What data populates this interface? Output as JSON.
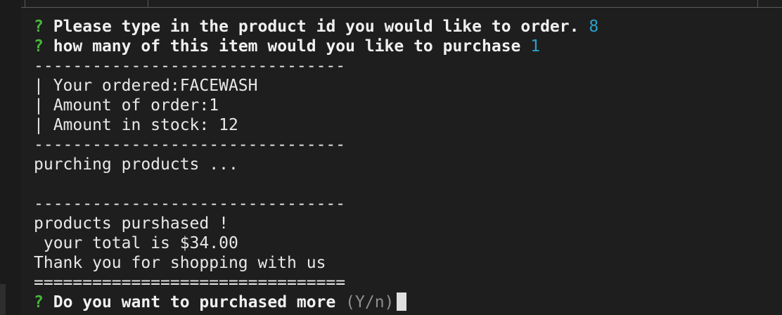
{
  "terminal": {
    "q1": {
      "mark": "?",
      "prompt": "Please type in the product id you would like to order.",
      "answer": "8"
    },
    "q2": {
      "mark": "?",
      "prompt": "how many of this item would you like to purchase",
      "answer": "1"
    },
    "divider": "--------------------------------",
    "order_lines": [
      "| Your ordered:FACEWASH",
      "| Amount of order:1",
      "| Amount in stock: 12"
    ],
    "processing": "purching products ...",
    "result_lines": [
      "products purshased !",
      " your total is $34.00",
      "Thank you for shopping with us"
    ],
    "double_divider": "================================",
    "q3": {
      "mark": "?",
      "prompt": "Do you want to purchased more",
      "hint": "(Y/n)"
    }
  }
}
